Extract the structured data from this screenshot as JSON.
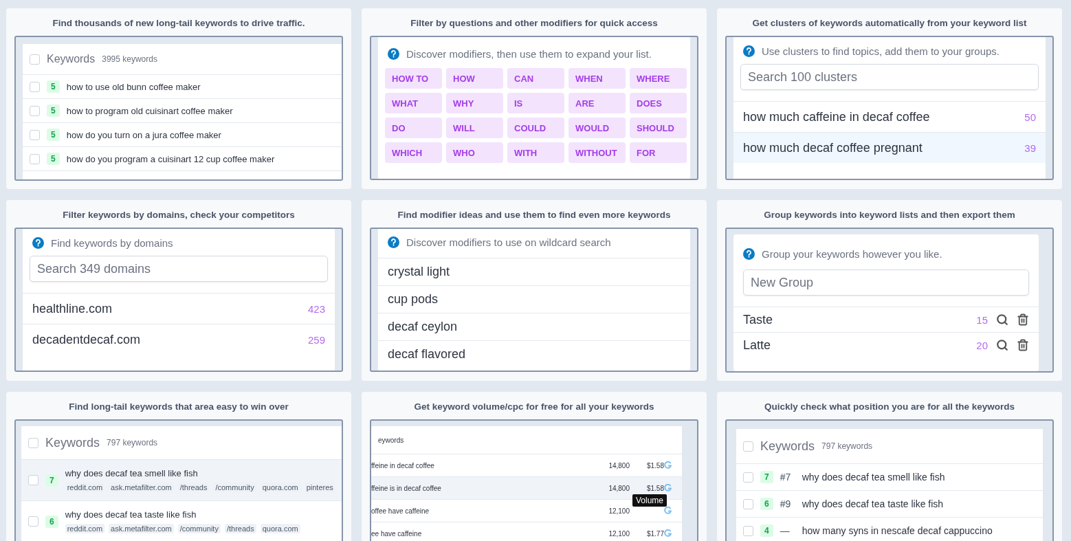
{
  "cards": [
    {
      "kind": "keywords",
      "title": "Find thousands of new long-tail keywords to drive traffic.",
      "header": {
        "label": "Keywords",
        "count": "3995 keywords",
        "checked": false
      },
      "rows": [
        {
          "score": "5",
          "text": "how to use old bunn coffee maker",
          "checked": false
        },
        {
          "score": "5",
          "text": "how to program old cuisinart coffee maker",
          "checked": false
        },
        {
          "score": "5",
          "text": "how do you turn on a jura coffee maker",
          "checked": false
        },
        {
          "score": "5",
          "text": "how do you program a cuisinart 12 cup coffee maker",
          "checked": false
        }
      ]
    },
    {
      "kind": "modifiers",
      "title": "Filter by questions and other modifiers for quick access",
      "hint": "Discover modifiers, then use them to expand your list.",
      "chips": [
        "HOW TO",
        "HOW",
        "CAN",
        "WHEN",
        "WHERE",
        "WHAT",
        "WHY",
        "IS",
        "ARE",
        "DOES",
        "DO",
        "WILL",
        "COULD",
        "WOULD",
        "SHOULD",
        "WHICH",
        "WHO",
        "WITH",
        "WITHOUT",
        "FOR"
      ]
    },
    {
      "kind": "search_list",
      "title": "Get clusters of keywords automatically from your keyword list",
      "hint": "Use clusters to find topics, add them to your groups.",
      "placeholder": "Search 100 clusters",
      "items": [
        {
          "text": "how much caffeine in decaf coffee",
          "count": "50",
          "selected": false
        },
        {
          "text": "how much decaf coffee pregnant",
          "count": "39",
          "selected": true
        }
      ]
    },
    {
      "kind": "search_list",
      "title": "Filter keywords by domains, check your competitors",
      "hint": "Find keywords by domains",
      "placeholder": "Search 349 domains",
      "items": [
        {
          "text": "healthline.com",
          "count": "423",
          "selected": false
        },
        {
          "text": "decadentdecaf.com",
          "count": "259",
          "selected": false
        }
      ]
    },
    {
      "kind": "plain_list",
      "title": "Find modifier ideas and use them to find even more keywords",
      "hint": "Discover modifiers to use on wildcard search",
      "items": [
        "crystal light",
        "cup pods",
        "decaf ceylon",
        "decaf flavored"
      ]
    },
    {
      "kind": "groups",
      "title": "Group keywords into keyword lists and then export them",
      "hint": "Group your keywords however you like.",
      "placeholder": "New Group",
      "groups": [
        {
          "name": "Taste",
          "count": "15"
        },
        {
          "name": "Latte",
          "count": "20"
        }
      ]
    },
    {
      "kind": "longtail",
      "title": "Find long-tail keywords that area easy to win over",
      "header": {
        "label": "Keywords",
        "count": "797 keywords",
        "checked": false
      },
      "rows": [
        {
          "score": "7",
          "text": "why does decaf tea smell like fish",
          "sources": [
            "reddit.com",
            "ask.metafilter.com",
            "/threads",
            "/community",
            "quora.com",
            "pinteres"
          ],
          "checked": false,
          "selected": true
        },
        {
          "score": "6",
          "text": "why does decaf tea taste like fish",
          "sources": [
            "reddit.com",
            "ask.metafilter.com",
            "/community",
            "/threads",
            "quora.com"
          ],
          "checked": false,
          "selected": false
        }
      ]
    },
    {
      "kind": "volume",
      "title": "Get keyword volume/cpc for free for all your keywords",
      "header": "eywords",
      "tooltip": "Volume",
      "rows": [
        {
          "text": "ffeine in decaf coffee",
          "volume": "14,800",
          "cpc": "$1.58",
          "selected": false
        },
        {
          "text": "ffeine is in decaf coffee",
          "volume": "14,800",
          "cpc": "$1.58",
          "selected": true
        },
        {
          "text": "offee have caffeine",
          "volume": "12,100",
          "selected": false
        },
        {
          "text": "ee have caffeine",
          "volume": "12,100",
          "cpc": "$1.77",
          "selected": false
        }
      ]
    },
    {
      "kind": "positions",
      "title": "Quickly check what position you are for all the keywords",
      "header": {
        "label": "Keywords",
        "count": "797 keywords",
        "checked": false
      },
      "rows": [
        {
          "score": "7",
          "rank": "#7",
          "text": "why does decaf tea smell like fish",
          "checked": false
        },
        {
          "score": "6",
          "rank": "#9",
          "text": "why does decaf tea taste like fish",
          "checked": false
        },
        {
          "score": "4",
          "rank": "—",
          "text": "how many syns in nescafe decaf cappuccino",
          "checked": false
        }
      ]
    }
  ]
}
